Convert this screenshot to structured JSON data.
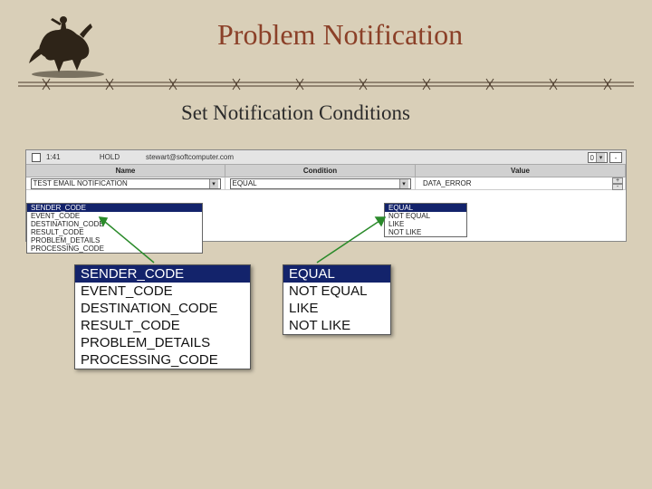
{
  "title": "Problem Notification",
  "subtitle": "Set Notification Conditions",
  "panel": {
    "topbar": {
      "id": "1:41",
      "status": "HOLD",
      "email": "stewart@softcomputer.com",
      "right_value": "0"
    },
    "headers": {
      "name": "Name",
      "condition": "Condition",
      "value": "Value"
    },
    "row": {
      "name": "TEST EMAIL NOTIFICATION",
      "condition": "EQUAL",
      "value": "DATA_ERROR",
      "add": "+",
      "sub": "-"
    },
    "name_dropdown": {
      "selected": "SENDER_CODE",
      "options": [
        "EVENT_CODE",
        "DESTINATION_CODE",
        "RESULT_CODE",
        "PROBLEM_DETAILS",
        "PROCESSING_CODE"
      ]
    },
    "cond_dropdown": {
      "selected": "EQUAL",
      "options": [
        "NOT EQUAL",
        "LIKE",
        "NOT LIKE"
      ]
    }
  },
  "closeup_name": {
    "selected": "SENDER_CODE",
    "options": [
      "EVENT_CODE",
      "DESTINATION_CODE",
      "RESULT_CODE",
      "PROBLEM_DETAILS",
      "PROCESSING_CODE"
    ]
  },
  "closeup_cond": {
    "selected": "EQUAL",
    "options": [
      "NOT EQUAL",
      "LIKE",
      "NOT LIKE"
    ]
  }
}
